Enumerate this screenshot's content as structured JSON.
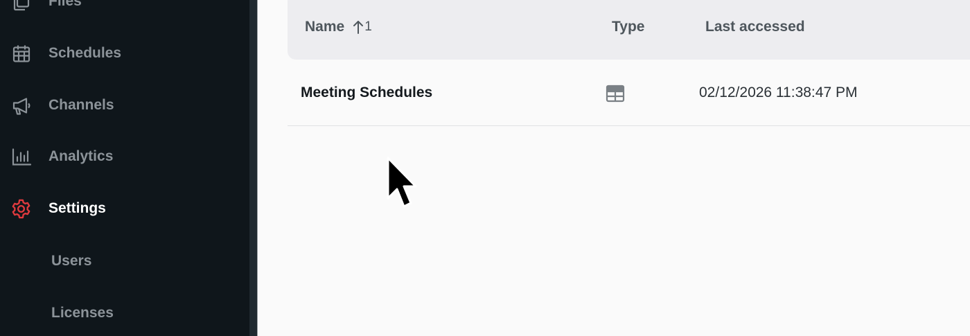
{
  "sidebar": {
    "items": [
      {
        "label": "Files",
        "icon": "files-icon"
      },
      {
        "label": "Schedules",
        "icon": "calendar-icon"
      },
      {
        "label": "Channels",
        "icon": "megaphone-icon"
      },
      {
        "label": "Analytics",
        "icon": "bar-chart-icon"
      },
      {
        "label": "Settings",
        "icon": "gear-icon",
        "active": true,
        "accent": "#e03a3e"
      }
    ],
    "sub_items": [
      {
        "label": "Users"
      },
      {
        "label": "Licenses"
      }
    ]
  },
  "table": {
    "columns": [
      {
        "label": "Name",
        "sort": "1"
      },
      {
        "label": "Type"
      },
      {
        "label": "Last accessed"
      }
    ],
    "rows": [
      {
        "name": "Meeting Schedules",
        "type_icon": "table-icon",
        "last_accessed": "02/12/2026 11:38:47 PM"
      }
    ]
  }
}
